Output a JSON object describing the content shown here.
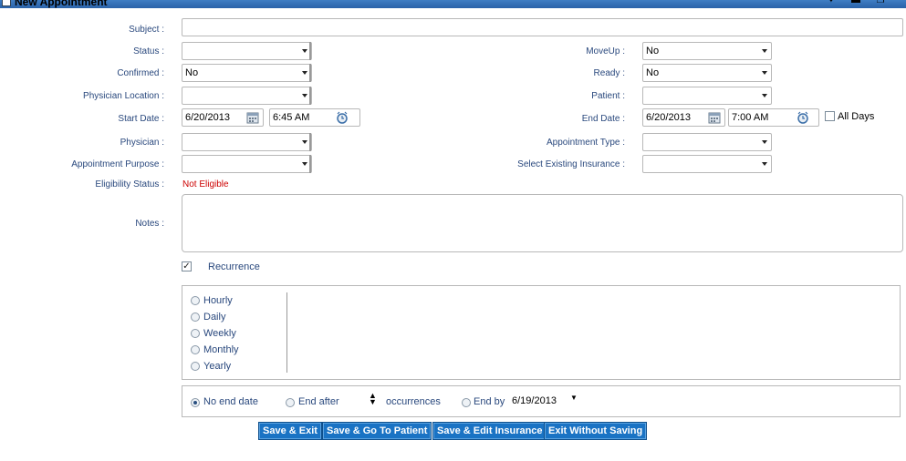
{
  "window": {
    "title": "New Appointment"
  },
  "form": {
    "subject": {
      "label": "Subject :",
      "value": ""
    },
    "status": {
      "label": "Status :",
      "value": ""
    },
    "moveup": {
      "label": "MoveUp :",
      "value": "No"
    },
    "confirmed": {
      "label": "Confirmed :",
      "value": "No"
    },
    "ready": {
      "label": "Ready :",
      "value": "No"
    },
    "physician_location": {
      "label": "Physician Location :",
      "value": ""
    },
    "patient": {
      "label": "Patient :",
      "value": ""
    },
    "start_date": {
      "label": "Start Date :",
      "date": "6/20/2013",
      "time": "6:45 AM"
    },
    "end_date": {
      "label": "End Date :",
      "date": "6/20/2013",
      "time": "7:00 AM"
    },
    "all_days": {
      "label": "All Days",
      "checked": false
    },
    "physician": {
      "label": "Physician :",
      "value": ""
    },
    "appointment_type": {
      "label": "Appointment Type :",
      "value": ""
    },
    "appointment_purpose": {
      "label": "Appointment Purpose :",
      "value": ""
    },
    "existing_insurance": {
      "label": "Select Existing Insurance :",
      "value": ""
    },
    "eligibility": {
      "label": "Eligibility Status :",
      "value": "Not Eligible",
      "color": "#cc0000"
    },
    "notes": {
      "label": "Notes :",
      "value": ""
    }
  },
  "recurrence": {
    "label": "Recurrence",
    "checked": true,
    "frequencies": [
      "Hourly",
      "Daily",
      "Weekly",
      "Monthly",
      "Yearly"
    ],
    "end_options": {
      "no_end": "No end date",
      "end_after": "End after",
      "occurrences": "occurrences",
      "end_by": "End by",
      "end_by_date": "6/19/2013",
      "selected": "No end date"
    }
  },
  "buttons": {
    "save_exit": "Save & Exit",
    "save_patient": "Save & Go To Patient",
    "save_insurance": "Save & Edit Insurance",
    "exit": "Exit Without Saving"
  },
  "colors": {
    "label": "#29487d",
    "button": "#1a73c4",
    "title_bar": "#2a62a8",
    "error": "#cc0000"
  }
}
